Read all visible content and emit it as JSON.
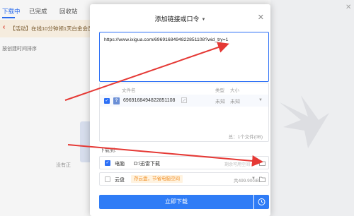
{
  "background": {
    "tabs": [
      {
        "label": "下载中"
      },
      {
        "label": "已完成"
      },
      {
        "label": "回收站"
      }
    ],
    "banner_text": "【活动】在线10分钟领1天白金会员",
    "sort_text": "按创建时间排序",
    "empty_text": "没有正"
  },
  "dialog": {
    "title": "添加链接或口令",
    "url_value": "https://www.ixigua.com/6969168494822851108?wid_try=1",
    "file_table": {
      "headers": {
        "name": "文件名",
        "type": "类型",
        "size": "大小"
      },
      "rows": [
        {
          "name": "6969168494822851108",
          "type": "未知",
          "size": "未知",
          "icon": "question-file-icon"
        }
      ],
      "summary": "总：1个文件(0B)"
    },
    "download_to_label": "下载到:",
    "locations": [
      {
        "name": "电脑",
        "path": "D:\\迅雷下载",
        "free": "剩余可用空间",
        "checked": true
      },
      {
        "name": "云盘",
        "badge": "存云盘，节省电脑空间",
        "size": "共499.90GB",
        "checked": false
      }
    ],
    "download_button": "立即下载"
  },
  "colors": {
    "accent": "#2b6ff6",
    "arrow": "#e53935",
    "badge_bg": "#fff3e0",
    "badge_text": "#f08a1c"
  }
}
